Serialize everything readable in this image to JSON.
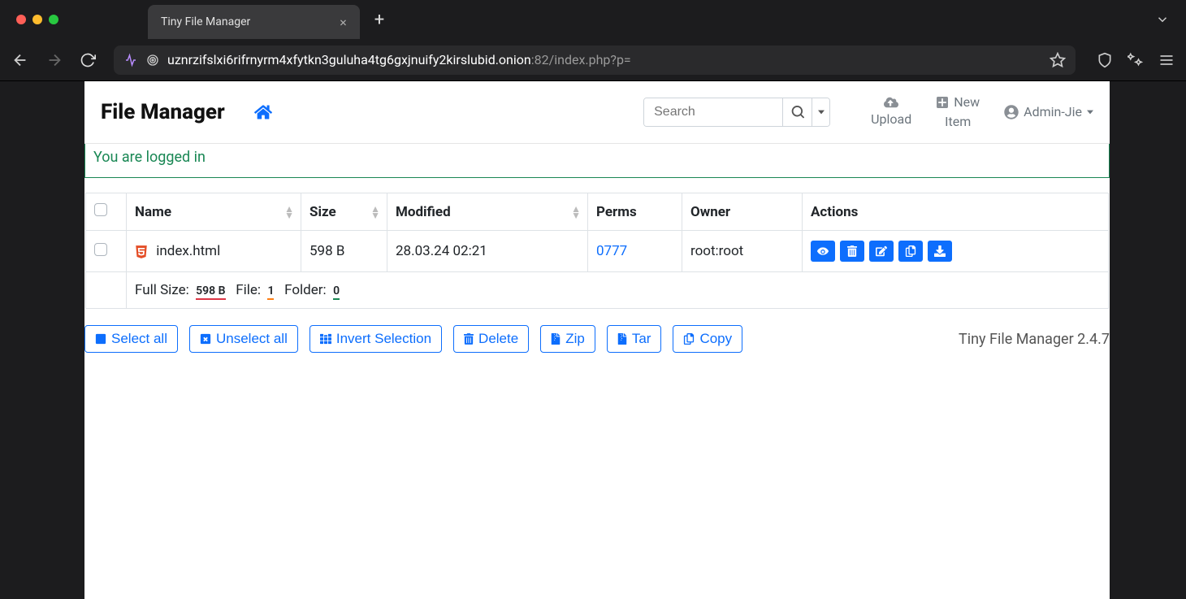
{
  "browser": {
    "tab_title": "Tiny File Manager",
    "url_host": "uznrzifslxi6rifrnyrm4xfytkn3guluha4tg6gxjnuify2kirslubid.onion",
    "url_path": ":82/index.php?p="
  },
  "header": {
    "brand": "File Manager",
    "search_placeholder": "Search",
    "upload_label": "Upload",
    "new_item_label_line1": "New",
    "new_item_label_line2": "Item",
    "user_label": "Admin-Jie"
  },
  "alert": {
    "message": "You are logged in"
  },
  "table": {
    "headers": {
      "name": "Name",
      "size": "Size",
      "modified": "Modified",
      "perms": "Perms",
      "owner": "Owner",
      "actions": "Actions"
    },
    "rows": [
      {
        "name": "index.html",
        "size": "598 B",
        "modified": "28.03.24 02:21",
        "perms": "0777",
        "owner": "root:root"
      }
    ],
    "summary": {
      "full_size_label": "Full Size:",
      "full_size_value": "598 B",
      "file_label": "File:",
      "file_value": "1",
      "folder_label": "Folder:",
      "folder_value": "0"
    }
  },
  "bulk": {
    "select_all": "Select all",
    "unselect_all": "Unselect all",
    "invert": "Invert Selection",
    "delete": "Delete",
    "zip": "Zip",
    "tar": "Tar",
    "copy": "Copy"
  },
  "footer": {
    "text": "Tiny File Manager 2.4.7"
  }
}
